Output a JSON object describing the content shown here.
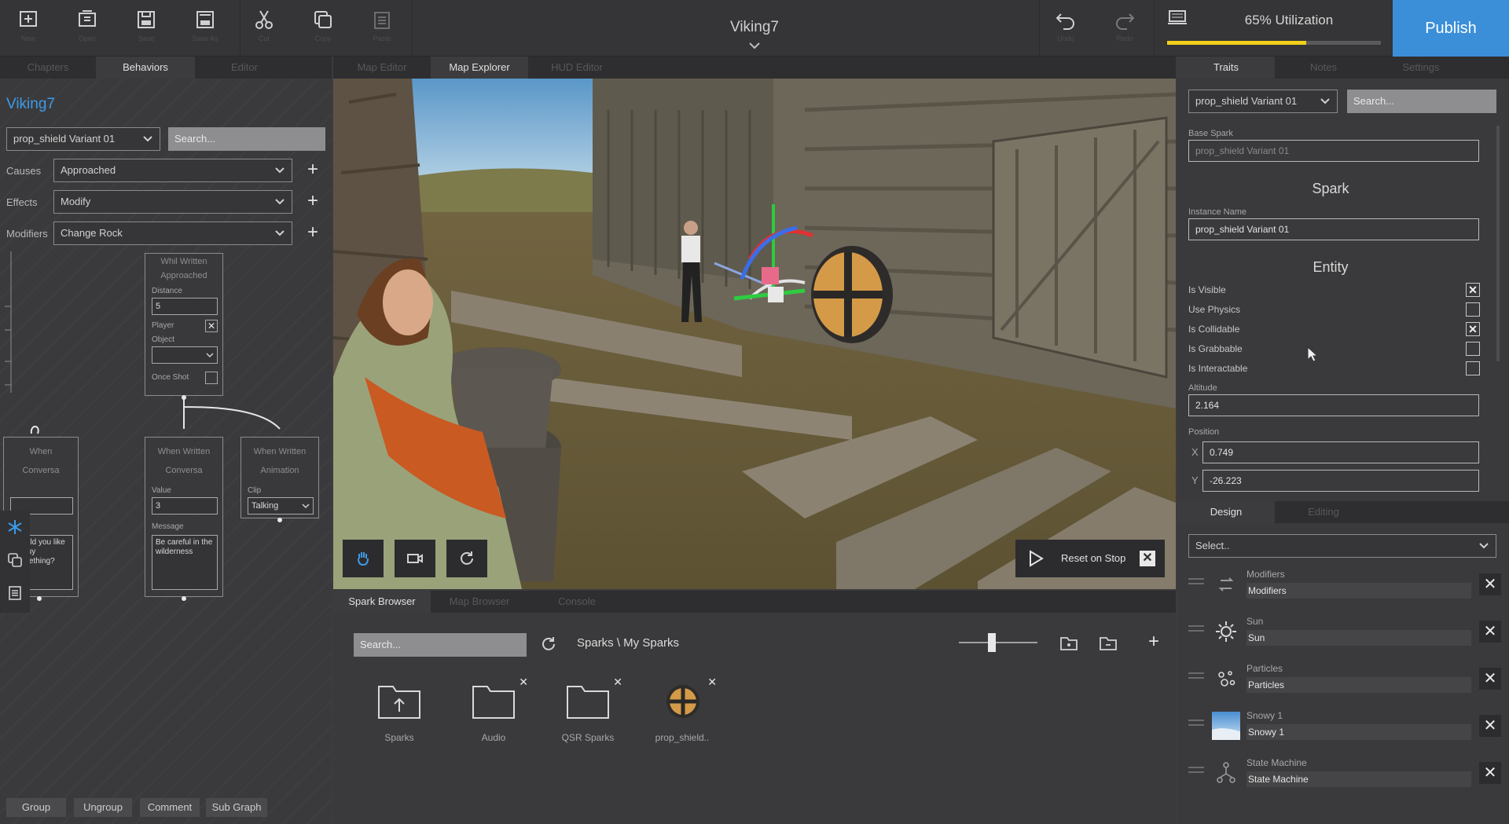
{
  "app": {
    "doc_title": "Viking7",
    "utilization_label": "65% Utilization",
    "utilization_fraction": 0.65,
    "publish_label": "Publish"
  },
  "toolbar": {
    "tools": [
      {
        "icon": "new-scene-icon",
        "label": "New"
      },
      {
        "icon": "open-scene-icon",
        "label": "Open"
      },
      {
        "icon": "save-icon",
        "label": "Save"
      },
      {
        "icon": "save-as-icon",
        "label": "Save As"
      },
      {
        "icon": "cut-icon",
        "label": "Cut"
      },
      {
        "icon": "copy-icon",
        "label": "Copy"
      },
      {
        "icon": "paste-icon",
        "label": "Paste"
      },
      {
        "icon": "undo-icon",
        "label": "Undo"
      },
      {
        "icon": "redo-icon",
        "label": "Redo"
      },
      {
        "icon": "devices-icon",
        "label": ""
      }
    ]
  },
  "left_tabs": [
    "Chapters",
    "Behaviors",
    "Editor"
  ],
  "center_tabs": [
    "Map Editor",
    "Map Explorer",
    "HUD Editor"
  ],
  "right_tabs": [
    "Traits",
    "Notes",
    "Settings"
  ],
  "behaviors": {
    "title": "Viking7",
    "selector_value": "prop_shield Variant 01",
    "search_placeholder": "Search...",
    "causes_label": "Causes",
    "causes_value": "Approached",
    "effects_label": "Effects",
    "effects_value": "Modify",
    "modifiers_label": "Modifiers",
    "modifiers_value": "Change Rock",
    "graph": {
      "node1": {
        "title": "Whil Written",
        "subtitle": "Approached",
        "distance_label": "Distance",
        "distance_value": "5",
        "player_label": "Player",
        "player_checked": "✕",
        "object_label": "Object",
        "once_label": "Once Shot"
      },
      "node2": {
        "title": "When Written",
        "subtitle": "Conversa",
        "value_label": "Value",
        "value": "3",
        "message_label": "Message",
        "message": "Be careful in the wilderness"
      },
      "node3": {
        "title": "When Written",
        "subtitle": "Animation",
        "clip_label": "Clip",
        "clip_value": "Talking"
      },
      "node4": {
        "title": "When",
        "subtitle": "Conversa",
        "message": "Would you like to buy something?"
      }
    },
    "bottom_buttons": [
      "Group",
      "Ungroup",
      "Comment",
      "Sub Graph"
    ]
  },
  "viewport": {
    "reset_label": "Reset on Stop"
  },
  "bottom_tabs": [
    "Spark Browser",
    "Map Browser",
    "Console"
  ],
  "browser": {
    "search_placeholder": "Search...",
    "breadcrumb": "Sparks \\ My Sparks",
    "assets": [
      {
        "icon": "folder-up-icon",
        "label": "Sparks"
      },
      {
        "icon": "folder-icon",
        "label": "Audio"
      },
      {
        "icon": "folder-icon",
        "label": "QSR Sparks"
      },
      {
        "icon": "shield-thumbnail-icon",
        "label": "prop_shield.."
      }
    ]
  },
  "traits": {
    "selector_value": "prop_shield Variant 01",
    "search_placeholder": "Search...",
    "base_spark_label": "Base Spark",
    "base_spark_value": "prop_shield Variant 01",
    "spark_heading": "Spark",
    "instance_name_label": "Instance Name",
    "instance_name_value": "prop_shield Variant 01",
    "entity_heading": "Entity",
    "checks": [
      {
        "label": "Is Visible",
        "mark": "✕"
      },
      {
        "label": "Use Physics",
        "mark": ""
      },
      {
        "label": "Is Collidable",
        "mark": "✕"
      },
      {
        "label": "Is Grabbable",
        "mark": ""
      },
      {
        "label": "Is Interactable",
        "mark": ""
      }
    ],
    "altitude_label": "Altitude",
    "altitude_value": "2.164",
    "position_label": "Position",
    "pos_x_label": "X",
    "pos_x_value": "0.749",
    "pos_y_label": "Y",
    "pos_y_value": "-26.223"
  },
  "components_tabs": [
    "Design",
    "Editing"
  ],
  "components": {
    "select_placeholder": "Select..",
    "items": [
      {
        "icon": "modifiers-icon",
        "name": "Modifiers",
        "value": "Modifiers"
      },
      {
        "icon": "sun-icon",
        "name": "Sun",
        "value": "Sun"
      },
      {
        "icon": "particles-icon",
        "name": "Particles",
        "value": "Particles"
      },
      {
        "icon": "snowy-sky-icon",
        "name": "Snowy 1",
        "value": "Snowy 1"
      },
      {
        "icon": "state-machine-icon",
        "name": "State Machine",
        "value": "State Machine"
      }
    ]
  }
}
